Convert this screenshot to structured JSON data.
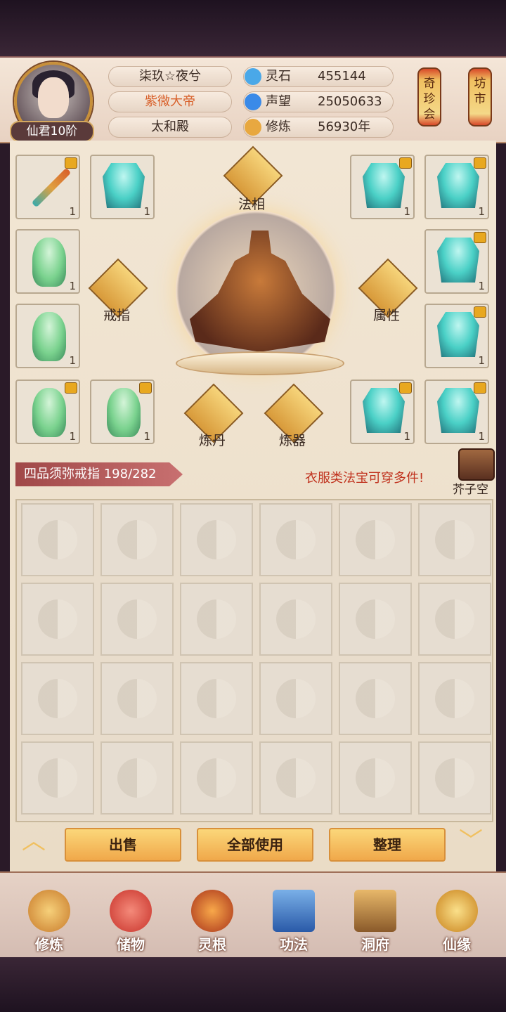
{
  "player": {
    "name": "柒玖☆夜兮",
    "title": "紫微大帝",
    "hall": "太和殿",
    "rank": "仙君10阶"
  },
  "resources": [
    {
      "label": "灵石",
      "value": "455144",
      "icon": "spirit-stone-icon",
      "color": "#4aa8e8"
    },
    {
      "label": "声望",
      "value": "25050633",
      "icon": "reputation-icon",
      "color": "#3a8ae8"
    },
    {
      "label": "修炼",
      "value": "56930年",
      "icon": "cultivation-icon",
      "color": "#e8a840"
    }
  ],
  "lanterns": [
    "奇珍会",
    "坊市"
  ],
  "equipment": {
    "center_labels": {
      "dharma": "法相",
      "ring": "戒指",
      "attributes": "属性",
      "alchemy": "炼丹",
      "forging": "炼器"
    },
    "slots_left": [
      {
        "type": "sword",
        "count": "1",
        "locked": true
      },
      {
        "type": "robe",
        "count": "1",
        "locked": false
      },
      {
        "type": "spirit",
        "count": "1",
        "locked": false
      },
      {
        "type": "spirit",
        "count": "1",
        "locked": false
      },
      {
        "type": "spirit",
        "count": "1",
        "locked": true
      },
      {
        "type": "spirit",
        "count": "1",
        "locked": true
      }
    ],
    "slots_right": [
      {
        "type": "robe",
        "count": "1",
        "locked": true
      },
      {
        "type": "robe",
        "count": "1",
        "locked": true
      },
      {
        "type": "robe",
        "count": "1",
        "locked": true
      },
      {
        "type": "robe",
        "count": "1",
        "locked": true
      },
      {
        "type": "robe",
        "count": "1",
        "locked": true
      },
      {
        "type": "robe",
        "count": "1",
        "locked": true
      }
    ]
  },
  "storage": {
    "ring_label": "四品须弥戒指 198/282",
    "hint": "衣服类法宝可穿多件!",
    "space_label": "芥子空间"
  },
  "actions": {
    "sell": "出售",
    "use_all": "全部使用",
    "sort": "整理"
  },
  "nav": [
    {
      "label": "修炼",
      "icon": "cultivation-nav-icon",
      "color": "#e0a040"
    },
    {
      "label": "储物",
      "icon": "storage-bag-icon",
      "color": "#d84a4a"
    },
    {
      "label": "灵根",
      "icon": "spirit-root-icon",
      "color": "#e86a2a"
    },
    {
      "label": "功法",
      "icon": "technique-book-icon",
      "color": "#3a7ac8"
    },
    {
      "label": "洞府",
      "icon": "cave-residence-icon",
      "color": "#c8904a"
    },
    {
      "label": "仙缘",
      "icon": "immortal-fate-icon",
      "color": "#e8b040"
    }
  ]
}
